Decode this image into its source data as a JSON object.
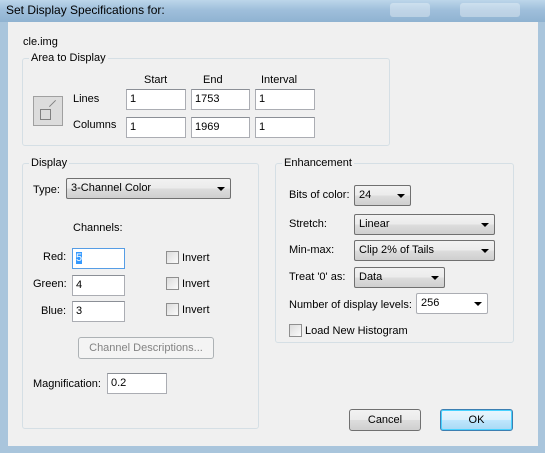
{
  "window": {
    "title": "Set Display Specifications for:"
  },
  "filename": "cle.img",
  "area": {
    "group_title": "Area to Display",
    "col_start": "Start",
    "col_end": "End",
    "col_interval": "Interval",
    "lines_label": "Lines",
    "columns_label": "Columns",
    "lines_start": "1",
    "lines_end": "1753",
    "lines_interval": "1",
    "columns_start": "1",
    "columns_end": "1969",
    "columns_interval": "1"
  },
  "display": {
    "group_title": "Display",
    "type_label": "Type:",
    "type_value": "3-Channel Color",
    "channels_label": "Channels:",
    "red_label": "Red:",
    "red_value": "5",
    "green_label": "Green:",
    "green_value": "4",
    "blue_label": "Blue:",
    "blue_value": "3",
    "invert_label": "Invert",
    "invert_red_checked": false,
    "invert_green_checked": false,
    "invert_blue_checked": false,
    "channel_desc_button": "Channel Descriptions...",
    "magnification_label": "Magnification:",
    "magnification_value": "0.2"
  },
  "enhancement": {
    "group_title": "Enhancement",
    "bits_label": "Bits of color:",
    "bits_value": "24",
    "stretch_label": "Stretch:",
    "stretch_value": "Linear",
    "minmax_label": "Min-max:",
    "minmax_value": "Clip 2% of Tails",
    "treat0_label": "Treat '0' as:",
    "treat0_value": "Data",
    "levels_label": "Number of display levels:",
    "levels_value": "256",
    "load_histogram_label": "Load New Histogram",
    "load_histogram_checked": false
  },
  "buttons": {
    "cancel": "Cancel",
    "ok": "OK"
  }
}
